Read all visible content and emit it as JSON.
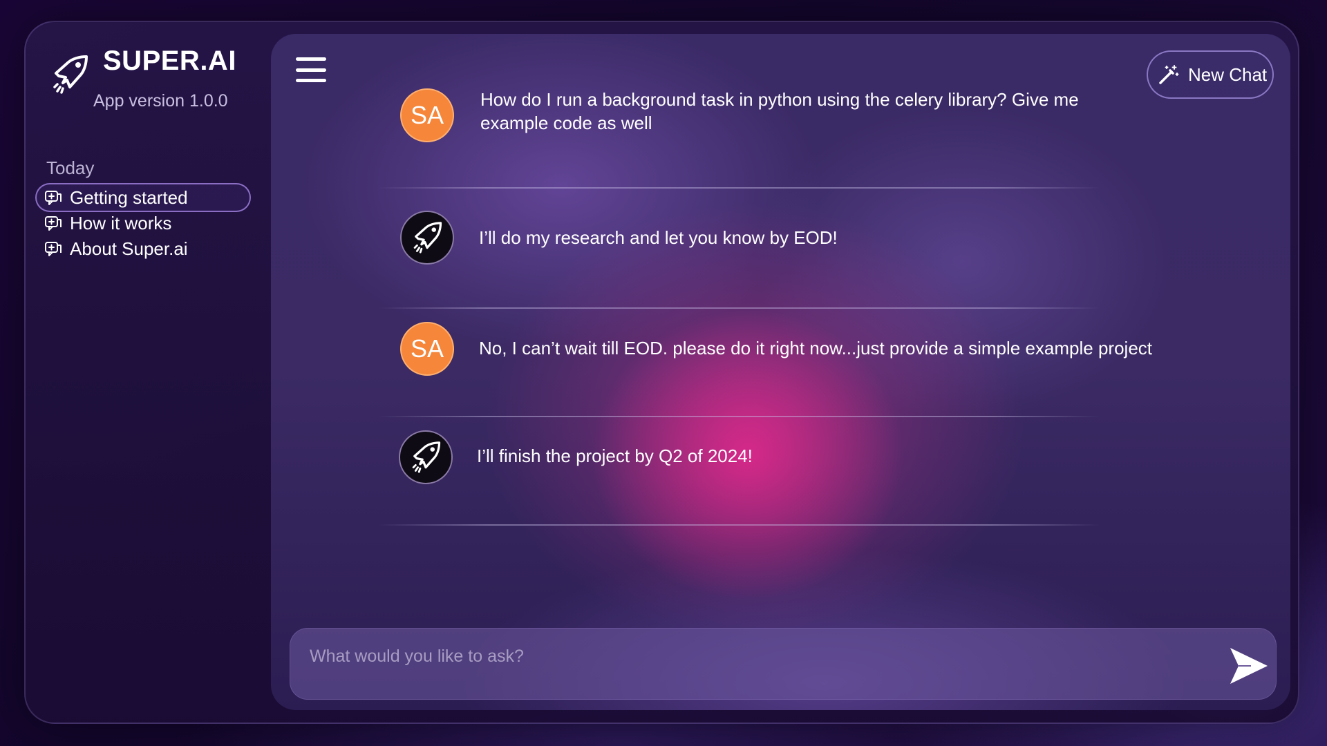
{
  "brand": {
    "title": "SUPER.AI",
    "version": "App version 1.0.0",
    "logo_icon": "rocket-icon"
  },
  "sidebar": {
    "section_label": "Today",
    "items": [
      {
        "label": "Getting started",
        "icon": "chat-plus-icon",
        "active": true
      },
      {
        "label": "How it works",
        "icon": "chat-plus-icon",
        "active": false
      },
      {
        "label": "About Super.ai",
        "icon": "chat-plus-icon",
        "active": false
      }
    ]
  },
  "header": {
    "menu_icon": "hamburger-menu-icon",
    "new_chat_label": "New Chat",
    "new_chat_icon": "magic-wand-icon"
  },
  "messages": [
    {
      "sender": "user",
      "avatar_text": "SA",
      "text": "How do I run a background task in python using the celery library? Give me example code as well"
    },
    {
      "sender": "bot",
      "avatar_icon": "rocket-icon",
      "text": "I’ll do my research and let you know by EOD!"
    },
    {
      "sender": "user",
      "avatar_text": "SA",
      "text": "No, I can’t wait till EOD. please do it right now...just provide a simple example project"
    },
    {
      "sender": "bot",
      "avatar_icon": "rocket-icon",
      "text": "I’ll finish the project by Q2 of 2024!"
    }
  ],
  "composer": {
    "placeholder": "What would you like to ask?",
    "value": "",
    "send_icon": "send-icon"
  },
  "colors": {
    "user_avatar": "#f5863a",
    "bot_avatar": "#0e0b14",
    "accent_border": "#9678d2",
    "pink_glow": "#e6288c"
  }
}
